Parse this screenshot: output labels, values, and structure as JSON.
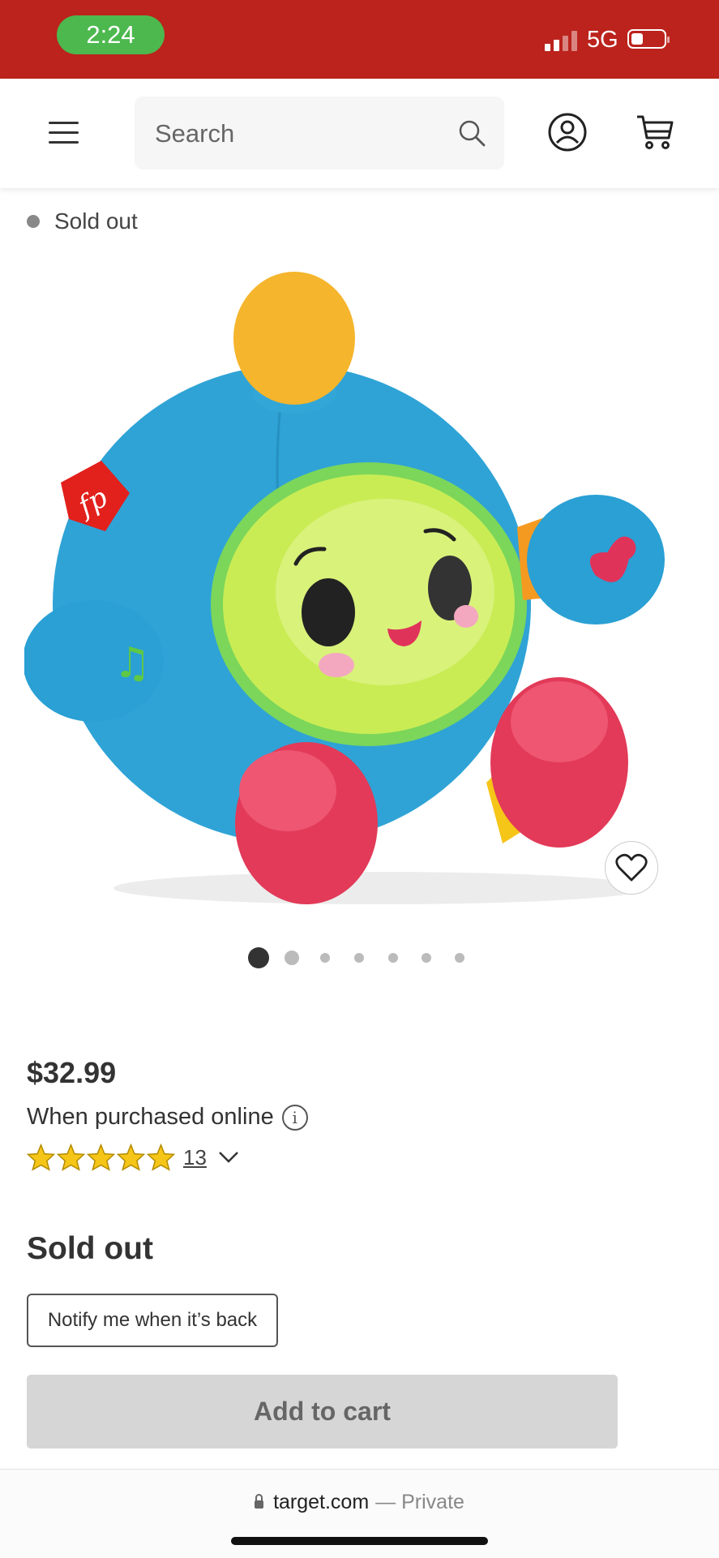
{
  "status_bar": {
    "time": "2:24",
    "network": "5G"
  },
  "header": {
    "search_placeholder": "Search",
    "icons": [
      "menu-icon",
      "search-icon",
      "account-icon",
      "cart-icon"
    ]
  },
  "product": {
    "stock_status": "Sold out",
    "image_count": 7,
    "active_image": 1,
    "price": "$32.99",
    "price_note": "When purchased online",
    "info_glyph": "i",
    "rating_value": 5,
    "rating_max": 5,
    "review_count": "13",
    "availability_heading": "Sold out",
    "notify_label": "Notify me when it’s back",
    "add_to_cart_label": "Add to cart"
  },
  "browser": {
    "domain": "target.com",
    "privacy": "— Private"
  },
  "colors": {
    "brand_red": "#bb231c",
    "time_pill": "#4db84e",
    "star": "#f5c518",
    "disabled_button": "#d6d6d6"
  }
}
